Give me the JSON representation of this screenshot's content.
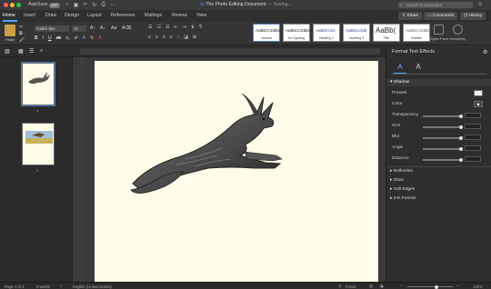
{
  "window": {
    "autosave_label": "AutoSave",
    "autosave_state": "OFF",
    "title": "The Photo Editing Document",
    "save_status": "— Saving...",
    "search_placeholder": "Search in Document"
  },
  "tabs": [
    "Home",
    "Insert",
    "Draw",
    "Design",
    "Layout",
    "References",
    "Mailings",
    "Review",
    "View"
  ],
  "header_buttons": {
    "share": "Share",
    "comments": "Comments",
    "history": "History"
  },
  "ribbon": {
    "paste": "Paste",
    "font_name": "Calibri (Bo...",
    "font_size": "12",
    "styles": [
      {
        "sample": "AaBbCcDdEe",
        "name": "Normal"
      },
      {
        "sample": "AaBbCcDdEe",
        "name": "No Spacing"
      },
      {
        "sample": "AaBbCcDc",
        "name": "Heading 1"
      },
      {
        "sample": "AaBbCcDdl",
        "name": "Heading 2"
      },
      {
        "sample": "AaBb(",
        "name": "Title"
      },
      {
        "sample": "AaBbCcDdEe",
        "name": "Subtitle"
      }
    ],
    "styles_pane": "Styles Pane",
    "sensitivity": "Sensitivity"
  },
  "thumbnails": [
    "1",
    "2"
  ],
  "format_pane": {
    "title": "Format Text Effects",
    "section": "Shadow",
    "props": [
      "Presets",
      "Color",
      "Transparency",
      "Size",
      "Blur",
      "Angle",
      "Distance"
    ],
    "collapsed": [
      "Reflection",
      "Glow",
      "Soft Edges",
      "3-D Format"
    ]
  },
  "status": {
    "page": "Page 1 of 2",
    "words": "0 words",
    "language": "English (United States)",
    "focus": "Focus",
    "zoom": "132%"
  }
}
